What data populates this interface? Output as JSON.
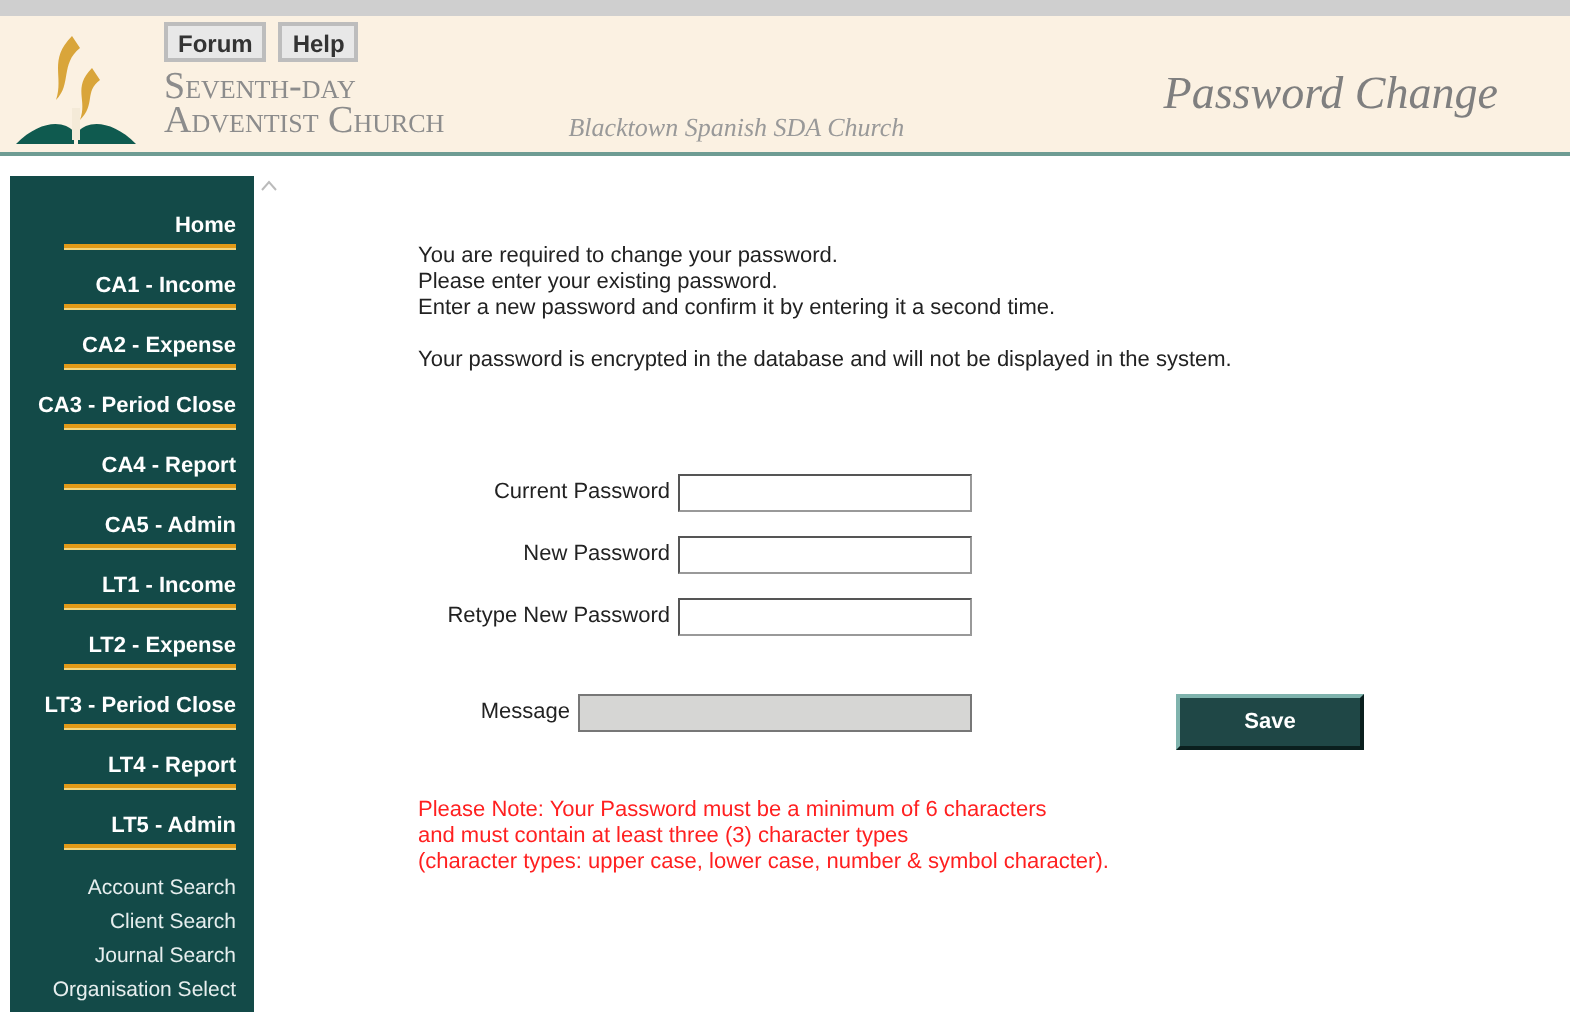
{
  "header": {
    "buttons": [
      "Forum",
      "Help"
    ],
    "org_name": [
      "Seventh-day",
      "Adventist Church"
    ],
    "congregation": "Blacktown Spanish SDA Church",
    "page_title": "Password Change"
  },
  "sidebar": {
    "items": [
      {
        "label": "Home",
        "kind": "main"
      },
      {
        "label": "CA1 - Income",
        "kind": "main"
      },
      {
        "label": "CA2 - Expense",
        "kind": "main"
      },
      {
        "label": "CA3 - Period Close",
        "kind": "main"
      },
      {
        "label": "CA4 - Report",
        "kind": "main"
      },
      {
        "label": "CA5 - Admin",
        "kind": "main"
      },
      {
        "label": "LT1 - Income",
        "kind": "main"
      },
      {
        "label": "LT2 - Expense",
        "kind": "main"
      },
      {
        "label": "LT3 - Period Close",
        "kind": "main"
      },
      {
        "label": "LT4 - Report",
        "kind": "main"
      },
      {
        "label": "LT5 - Admin",
        "kind": "main"
      },
      {
        "label": "Account Search",
        "kind": "sub"
      },
      {
        "label": "Client Search",
        "kind": "sub"
      },
      {
        "label": "Journal Search",
        "kind": "sub"
      },
      {
        "label": "Organisation Select",
        "kind": "sub"
      }
    ]
  },
  "intro": [
    "You are required to change your password.",
    "Please enter your existing password.",
    "Enter a new password and confirm it by entering it a second time."
  ],
  "encryption_note": "Your password is encrypted in the database and will not be displayed in the system.",
  "form": {
    "fields": [
      {
        "label": "Current Password"
      },
      {
        "label": "New Password"
      },
      {
        "label": "Retype New Password"
      }
    ],
    "message": {
      "label": "Message",
      "disabled": true
    },
    "save_button": "Save"
  },
  "rules_note": [
    "Please Note: Your Password must be a minimum of 6 characters",
    "and must contain at least three (3) character types",
    "(character types: upper case, lower case, number & symbol character)."
  ]
}
